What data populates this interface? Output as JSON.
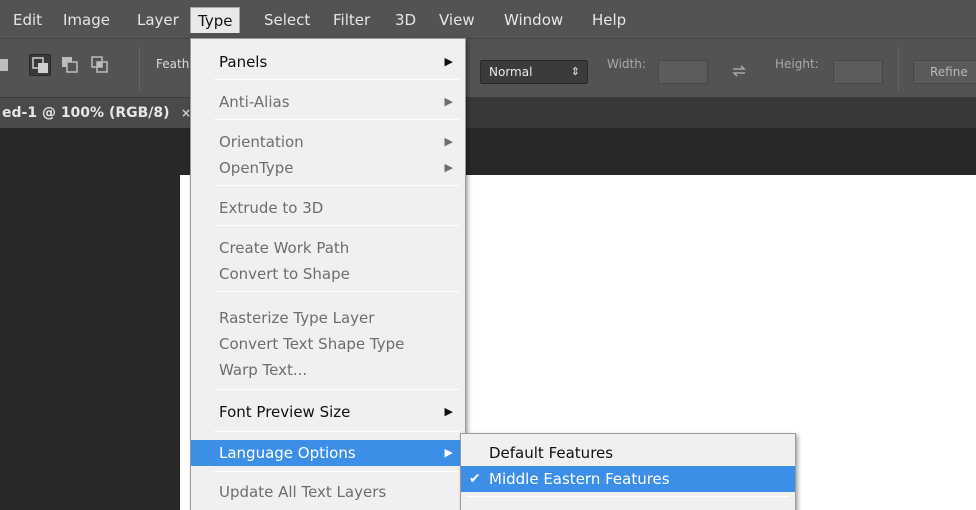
{
  "menubar": {
    "items": [
      "Edit",
      "Image",
      "Layer",
      "Type",
      "Select",
      "Filter",
      "3D",
      "View",
      "Window",
      "Help"
    ],
    "active": "Type"
  },
  "options_bar": {
    "feather_label": "Feath",
    "style_value": "Normal",
    "width_label": "Width:",
    "height_label": "Height:",
    "refine_label": "Refine"
  },
  "tab": {
    "title": "ed-1 @ 100% (RGB/8)",
    "close": "×"
  },
  "type_menu": {
    "items": [
      {
        "label": "Panels"
      },
      {
        "label": "Anti-Alias"
      },
      {
        "label": "Orientation"
      },
      {
        "label": "OpenType"
      },
      {
        "label": "Extrude to 3D"
      },
      {
        "label": "Create Work Path"
      },
      {
        "label": "Convert to Shape"
      },
      {
        "label": "Rasterize Type Layer"
      },
      {
        "label": "Convert Text Shape Type"
      },
      {
        "label": "Warp Text..."
      },
      {
        "label": "Font Preview Size"
      },
      {
        "label": "Language Options"
      },
      {
        "label": "Update All Text Layers"
      }
    ]
  },
  "language_submenu": {
    "items": [
      {
        "label": "Default Features",
        "checked": false
      },
      {
        "label": "Middle Eastern Features",
        "checked": true
      }
    ]
  },
  "icons": {
    "submenu_arrow": "▶",
    "check": "✔",
    "spinner": "⇕"
  },
  "colors": {
    "menu_highlight": "#3d8ee6",
    "menubar_bg": "#535353",
    "workspace_bg": "#282828"
  }
}
